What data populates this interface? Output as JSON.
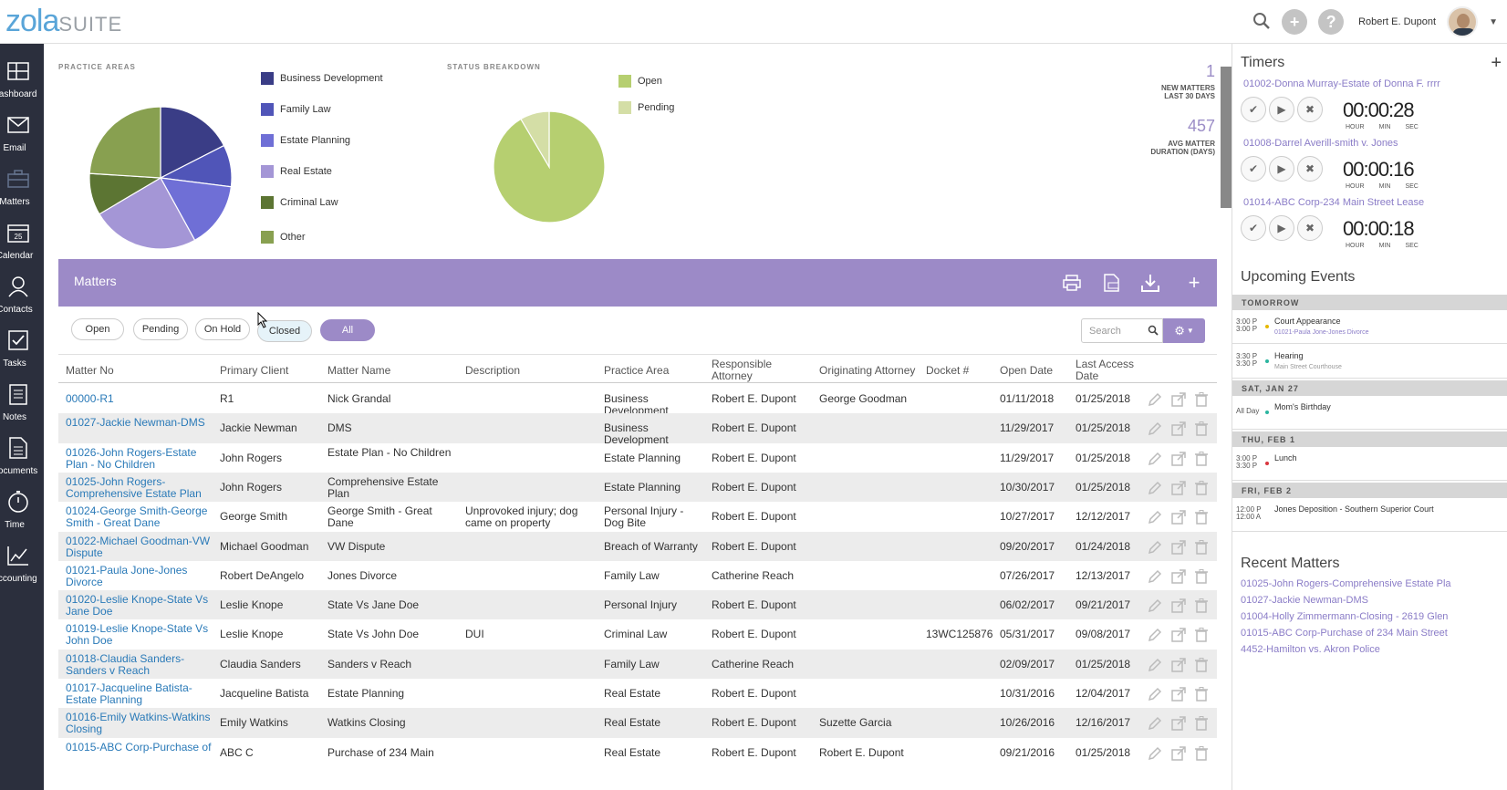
{
  "app": {
    "logo_main": "zola",
    "logo_suite": "SUITE"
  },
  "topbar": {
    "user_name": "Robert E. Dupont"
  },
  "nav": [
    {
      "label": "Dashboard"
    },
    {
      "label": "Email"
    },
    {
      "label": "Matters"
    },
    {
      "label": "Calendar",
      "badge": "25"
    },
    {
      "label": "Contacts"
    },
    {
      "label": "Tasks"
    },
    {
      "label": "Notes"
    },
    {
      "label": "Documents"
    },
    {
      "label": "Time"
    },
    {
      "label": "Accounting"
    }
  ],
  "charts": {
    "practice_label": "PRACTICE AREAS",
    "status_label": "STATUS BREAKDOWN",
    "colors": {
      "business_development": "#3a3d86",
      "family_law": "#5055b8",
      "estate_planning": "#6f6fd6",
      "real_estate": "#a496d6",
      "criminal_law": "#5c7533",
      "other": "#88a050",
      "open": "#b6cf70",
      "pending": "#d4dea6"
    }
  },
  "chart_data": [
    {
      "type": "pie",
      "title": "PRACTICE AREAS",
      "categories": [
        "Business Development",
        "Family Law",
        "Estate Planning",
        "Real Estate",
        "Criminal Law",
        "Other"
      ],
      "values": [
        17.5,
        9.5,
        15,
        24.5,
        9.5,
        24
      ]
    },
    {
      "type": "pie",
      "title": "STATUS BREAKDOWN",
      "categories": [
        "Open",
        "Pending"
      ],
      "values": [
        91.5,
        8.5
      ]
    }
  ],
  "stats": {
    "new_matters_value": "1",
    "new_matters_label1": "NEW MATTERS",
    "new_matters_label2": "LAST 30 DAYS",
    "avg_duration_value": "457",
    "avg_duration_label1": "AVG MATTER",
    "avg_duration_label2": "DURATION (DAYS)"
  },
  "matters": {
    "title": "Matters",
    "filters": [
      "Open",
      "Pending",
      "On Hold",
      "Closed",
      "All"
    ],
    "search_placeholder": "Search",
    "columns": [
      "Matter No",
      "Primary Client",
      "Matter Name",
      "Description",
      "Practice Area",
      "Responsible Attorney",
      "Originating Attorney",
      "Docket #",
      "Open Date",
      "Last Access Date"
    ],
    "rows": [
      {
        "no": "00000-R1",
        "client": "R1",
        "name": "Nick Grandal",
        "desc": "",
        "area": "Business Development",
        "resp": "Robert E. Dupont",
        "orig": "George Goodman",
        "docket": "",
        "open": "01/11/2018",
        "last": "01/25/2018"
      },
      {
        "no": "01027-Jackie Newman-DMS",
        "client": "Jackie Newman",
        "name": "DMS",
        "desc": "",
        "area": "Business Development",
        "resp": "Robert E. Dupont",
        "orig": "",
        "docket": "",
        "open": "11/29/2017",
        "last": "01/25/2018"
      },
      {
        "no": "01026-John Rogers-Estate Plan - No Children",
        "client": "John Rogers",
        "name": "Estate Plan - No Children",
        "desc": "",
        "area": "Estate Planning",
        "resp": "Robert E. Dupont",
        "orig": "",
        "docket": "",
        "open": "11/29/2017",
        "last": "01/25/2018"
      },
      {
        "no": "01025-John Rogers-Comprehensive Estate Plan",
        "client": "John Rogers",
        "name": "Comprehensive Estate Plan",
        "desc": "",
        "area": "Estate Planning",
        "resp": "Robert E. Dupont",
        "orig": "",
        "docket": "",
        "open": "10/30/2017",
        "last": "01/25/2018"
      },
      {
        "no": "01024-George Smith-George Smith - Great Dane",
        "client": "George Smith",
        "name": "George Smith - Great Dane",
        "desc": "Unprovoked injury; dog came on property",
        "area": "Personal Injury - Dog Bite",
        "resp": "Robert E. Dupont",
        "orig": "",
        "docket": "",
        "open": "10/27/2017",
        "last": "12/12/2017"
      },
      {
        "no": "01022-Michael Goodman-VW Dispute",
        "client": "Michael Goodman",
        "name": "VW Dispute",
        "desc": "",
        "area": "Breach of Warranty",
        "resp": "Robert E. Dupont",
        "orig": "",
        "docket": "",
        "open": "09/20/2017",
        "last": "01/24/2018"
      },
      {
        "no": "01021-Paula Jone-Jones Divorce",
        "client": "Robert DeAngelo",
        "name": "Jones Divorce",
        "desc": "",
        "area": "Family Law",
        "resp": "Catherine Reach",
        "orig": "",
        "docket": "",
        "open": "07/26/2017",
        "last": "12/13/2017"
      },
      {
        "no": "01020-Leslie Knope-State Vs Jane Doe",
        "client": "Leslie Knope",
        "name": "State Vs Jane Doe",
        "desc": "",
        "area": "Personal Injury",
        "resp": "Robert E. Dupont",
        "orig": "",
        "docket": "",
        "open": "06/02/2017",
        "last": "09/21/2017"
      },
      {
        "no": "01019-Leslie Knope-State Vs John Doe",
        "client": "Leslie Knope",
        "name": "State Vs John Doe",
        "desc": "DUI",
        "area": "Criminal Law",
        "resp": "Robert E. Dupont",
        "orig": "",
        "docket": "13WC125876",
        "open": "05/31/2017",
        "last": "09/08/2017"
      },
      {
        "no": "01018-Claudia Sanders-Sanders v Reach",
        "client": "Claudia Sanders",
        "name": "Sanders v Reach",
        "desc": "",
        "area": "Family Law",
        "resp": "Catherine Reach",
        "orig": "",
        "docket": "",
        "open": "02/09/2017",
        "last": "01/25/2018"
      },
      {
        "no": "01017-Jacqueline Batista-Estate Planning",
        "client": "Jacqueline Batista",
        "name": "Estate Planning",
        "desc": "",
        "area": "Real Estate",
        "resp": "Robert E. Dupont",
        "orig": "",
        "docket": "",
        "open": "10/31/2016",
        "last": "12/04/2017"
      },
      {
        "no": "01016-Emily Watkins-Watkins Closing",
        "client": "Emily Watkins",
        "name": "Watkins Closing",
        "desc": "",
        "area": "Real Estate",
        "resp": "Robert E. Dupont",
        "orig": "Suzette Garcia",
        "docket": "",
        "open": "10/26/2016",
        "last": "12/16/2017"
      },
      {
        "no": "01015-ABC Corp-Purchase of",
        "client": "ABC C",
        "name": "Purchase of 234 Main",
        "desc": "",
        "area": "Real Estate",
        "resp": "Robert E. Dupont",
        "orig": "Robert E. Dupont",
        "docket": "",
        "open": "09/21/2016",
        "last": "01/25/2018"
      }
    ]
  },
  "timers": {
    "title": "Timers",
    "items": [
      {
        "name": "01002-Donna Murray-Estate of Donna F. rrrr",
        "value": "00:00:28"
      },
      {
        "name": "01008-Darrel Averill-smith v. Jones",
        "value": "00:00:16"
      },
      {
        "name": "01014-ABC Corp-234 Main Street Lease",
        "value": "00:00:18"
      }
    ],
    "units": [
      "HOUR",
      "MIN",
      "SEC"
    ]
  },
  "events": {
    "title": "Upcoming Events",
    "groups": [
      {
        "day": "TOMORROW",
        "items": [
          {
            "time1": "3:00 P",
            "time2": "3:00 P",
            "title": "Court Appearance",
            "sub": "01021-Paula Jone-Jones Divorce",
            "dot": "#e6b800"
          },
          {
            "time1": "3:30 P",
            "time2": "3:30 P",
            "title": "Hearing",
            "sub": "Main Street Courthouse",
            "dot": "#2bb5a0"
          }
        ]
      },
      {
        "day": "SAT, JAN 27",
        "items": [
          {
            "time1": "All Day",
            "time2": "",
            "title": "Mom's Birthday",
            "sub": "",
            "dot": "#2bb5a0"
          }
        ]
      },
      {
        "day": "THU, FEB 1",
        "items": [
          {
            "time1": "3:00 P",
            "time2": "3:30 P",
            "title": "Lunch",
            "sub": "",
            "dot": "#d9363e"
          }
        ]
      },
      {
        "day": "FRI, FEB 2",
        "items": [
          {
            "time1": "12:00 P",
            "time2": "12:00 A",
            "title": "Jones Deposition - Southern Superior Court",
            "sub": "",
            "dot": ""
          }
        ]
      }
    ]
  },
  "recent": {
    "title": "Recent Matters",
    "items": [
      "01025-John Rogers-Comprehensive Estate Pla",
      "01027-Jackie Newman-DMS",
      "01004-Holly Zimmermann-Closing - 2619 Glen",
      "01015-ABC Corp-Purchase of 234 Main Street",
      "4452-Hamilton vs. Akron Police"
    ]
  }
}
